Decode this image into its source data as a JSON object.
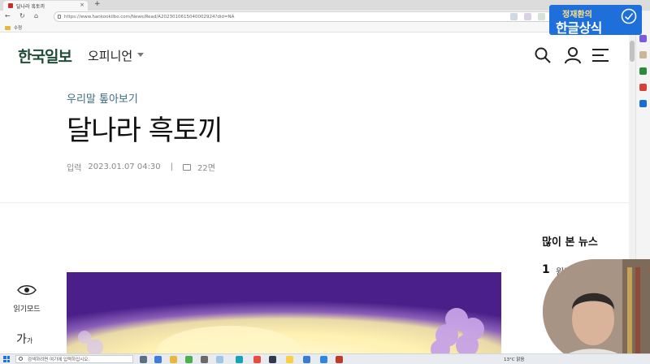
{
  "browser": {
    "tab_title": "달나라 흑토끼",
    "new_tab_symbol": "+",
    "close_symbol": "×",
    "url": "https://www.hankookilbo.com/News/Read/A2023010615040002924?did=NA",
    "bookmark_folder": "수정"
  },
  "site": {
    "logo": "한국일보",
    "section": "오피니언"
  },
  "article": {
    "category": "우리말 톺아보기",
    "headline": "달나라 흑토끼",
    "meta_label": "입력",
    "published": "2023.01.07 04:30",
    "separator": "|",
    "page_count": "22면"
  },
  "side_tools": {
    "reader_mode": "읽기모드",
    "font_size_big": "가",
    "font_size_small": "가"
  },
  "popular": {
    "title": "많이 본 뉴스",
    "first_rank": "1",
    "first_text": "원티"
  },
  "overlay_badge": {
    "line1": "정재환의",
    "line2": "한글상식"
  },
  "taskbar": {
    "search_placeholder": "검색하려면 여기에 입력하십시오.",
    "weather": "13°C 맑음"
  },
  "colors": {
    "logo_green": "#1f4d3a",
    "category_blue": "#3d6d86",
    "badge_blue": "#1e6fd9",
    "hero_purple": "#5b2a9c",
    "hero_glow": "#fff3b0"
  }
}
